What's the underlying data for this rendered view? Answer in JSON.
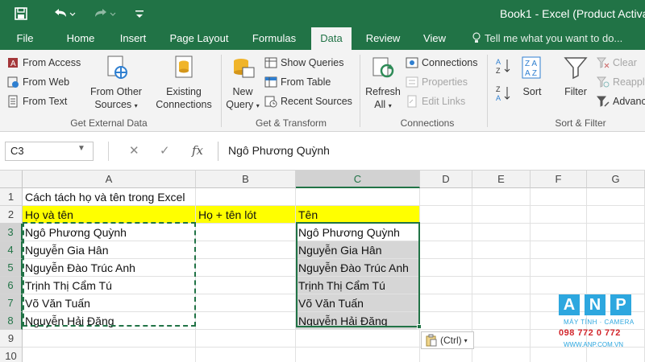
{
  "app": {
    "title": "Book1 - Excel (Product Activatio",
    "colors": {
      "brand": "#217346",
      "yellow": "#ffff00",
      "selection_gray": "#d6d6d6"
    }
  },
  "quick_access": {
    "save_icon": "save-icon",
    "undo_icon": "undo-icon",
    "redo_icon": "redo-icon",
    "customize_icon": "customize-icon"
  },
  "tabs": [
    {
      "label": "File"
    },
    {
      "label": "Home"
    },
    {
      "label": "Insert"
    },
    {
      "label": "Page Layout"
    },
    {
      "label": "Formulas"
    },
    {
      "label": "Data",
      "active": true
    },
    {
      "label": "Review"
    },
    {
      "label": "View"
    }
  ],
  "tell_me": "Tell me what you want to do...",
  "ribbon": {
    "get_external": {
      "label": "Get External Data",
      "from_access": "From Access",
      "from_web": "From Web",
      "from_text": "From Text",
      "from_other_1": "From Other",
      "from_other_2": "Sources",
      "existing_1": "Existing",
      "existing_2": "Connections"
    },
    "get_transform": {
      "label": "Get & Transform",
      "new_query_1": "New",
      "new_query_2": "Query",
      "show_queries": "Show Queries",
      "from_table": "From Table",
      "recent_sources": "Recent Sources"
    },
    "connections": {
      "label": "Connections",
      "refresh_1": "Refresh",
      "refresh_2": "All",
      "connections": "Connections",
      "properties": "Properties",
      "edit_links": "Edit Links"
    },
    "sort_filter": {
      "label": "Sort & Filter",
      "sort": "Sort",
      "filter": "Filter",
      "clear": "Clear",
      "reapply": "Reapply",
      "advanced": "Advanced"
    }
  },
  "formula_bar": {
    "name_box": "C3",
    "fx": "fx",
    "value": "Ngô Phương Quỳnh"
  },
  "columns": [
    "A",
    "B",
    "C",
    "D",
    "E",
    "F",
    "G"
  ],
  "rows": [
    "1",
    "2",
    "3",
    "4",
    "5",
    "6",
    "7",
    "8",
    "9",
    "10"
  ],
  "cells": {
    "A1": "Cách tách họ và tên trong Excel",
    "A2": "Họ và tên",
    "B2": "Họ + tên lót",
    "C2": "Tên",
    "A3": "Ngô Phương Quỳnh",
    "A4": "Nguyễn Gia Hân",
    "A5": "Nguyễn Đào Trúc Anh",
    "A6": "Trịnh Thị Cẩm Tú",
    "A7": "Võ Văn Tuấn",
    "A8": "Nguyễn Hải Đăng",
    "C3": "Ngô Phương Quỳnh",
    "C4": "Nguyễn Gia Hân",
    "C5": "Nguyễn Đào Trúc Anh",
    "C6": "Trịnh Thị Cẩm Tú",
    "C7": "Võ Văn Tuấn",
    "C8": "Nguyễn Hải Đăng"
  },
  "paste_options": "(Ctrl)",
  "watermark": {
    "letters": [
      "A",
      "N",
      "P"
    ],
    "tagline": "MÁY TÍNH · CAMERA",
    "phone": "098 772 0 772",
    "url": "WWW.ANP.COM.VN"
  }
}
